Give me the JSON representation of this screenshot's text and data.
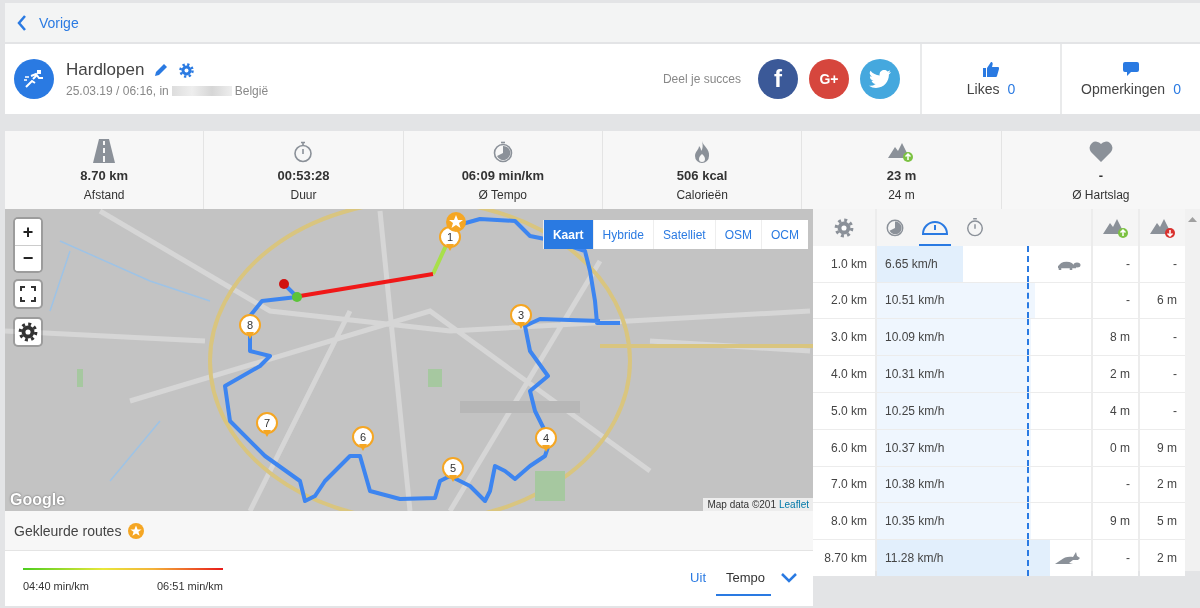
{
  "nav": {
    "back_label": "Vorige"
  },
  "activity": {
    "title": "Hardlopen",
    "date_time": "25.03.19 / 06:16, in",
    "place": "België",
    "share_label": "Deel je succes",
    "share_buttons": [
      {
        "kind": "facebook",
        "glyph": "f"
      },
      {
        "kind": "googleplus",
        "glyph": "G+"
      },
      {
        "kind": "twitter"
      }
    ],
    "likes": {
      "label": "Likes",
      "count": "0"
    },
    "comments": {
      "label": "Opmerkingen",
      "count": "0"
    }
  },
  "stats": [
    {
      "kind": "road",
      "value": "8.70 km",
      "label": "Afstand"
    },
    {
      "kind": "stopwatch",
      "value": "00:53:28",
      "label": "Duur"
    },
    {
      "kind": "pace",
      "value": "06:09 min/km",
      "label": "Ø Tempo"
    },
    {
      "kind": "flame",
      "value": "506 kcal",
      "label": "Calorieën"
    },
    {
      "kind": "ascent",
      "value": "23 m",
      "label": "24 m"
    },
    {
      "kind": "heart",
      "value": "-",
      "label": "Ø Hartslag"
    }
  ],
  "map": {
    "zoom_in": "+",
    "zoom_out": "−",
    "layers": [
      {
        "label": "Kaart",
        "selected": true
      },
      {
        "label": "Hybride",
        "selected": false
      },
      {
        "label": "Satelliet",
        "selected": false
      },
      {
        "label": "OSM",
        "selected": false
      },
      {
        "label": "OCM",
        "selected": false
      }
    ],
    "markers": [
      "1",
      "3",
      "4",
      "5",
      "6",
      "7",
      "8"
    ],
    "logo": "Google",
    "attribution": "Map data ©201",
    "attribution_link": "Leaflet"
  },
  "colored_routes": {
    "title": "Gekleurde routes",
    "min_label": "04:40 min/km",
    "max_label": "06:51 min/km",
    "options": [
      {
        "label": "Uit",
        "selected": false
      },
      {
        "label": "Tempo",
        "selected": true
      }
    ]
  },
  "splits": {
    "header_tabs": [
      {
        "kind": "pace",
        "selected": false
      },
      {
        "kind": "speed",
        "selected": true
      },
      {
        "kind": "time",
        "selected": false
      }
    ],
    "average_line": {
      "level": 0.7
    },
    "rows": [
      {
        "distance": "1.0 km",
        "speed": "6.65 km/h",
        "level": 0.4,
        "kind": "slowest",
        "ascent": "-",
        "descent": "-"
      },
      {
        "distance": "2.0 km",
        "speed": "10.51 km/h",
        "level": 0.74,
        "ascent": "-",
        "descent": "6 m"
      },
      {
        "distance": "3.0 km",
        "speed": "10.09 km/h",
        "level": 0.72,
        "ascent": "8 m",
        "descent": "-"
      },
      {
        "distance": "4.0 km",
        "speed": "10.31 km/h",
        "level": 0.72,
        "ascent": "2 m",
        "descent": "-"
      },
      {
        "distance": "5.0 km",
        "speed": "10.25 km/h",
        "level": 0.72,
        "ascent": "4 m",
        "descent": "-"
      },
      {
        "distance": "6.0 km",
        "speed": "10.37 km/h",
        "level": 0.72,
        "ascent": "0 m",
        "descent": "9 m"
      },
      {
        "distance": "7.0 km",
        "speed": "10.38 km/h",
        "level": 0.72,
        "ascent": "-",
        "descent": "2 m"
      },
      {
        "distance": "8.0 km",
        "speed": "10.35 km/h",
        "level": 0.72,
        "ascent": "9 m",
        "descent": "5 m"
      },
      {
        "distance": "8.70 km",
        "speed": "11.28 km/h",
        "level": 0.81,
        "kind": "fastest",
        "ascent": "-",
        "descent": "2 m"
      }
    ]
  }
}
